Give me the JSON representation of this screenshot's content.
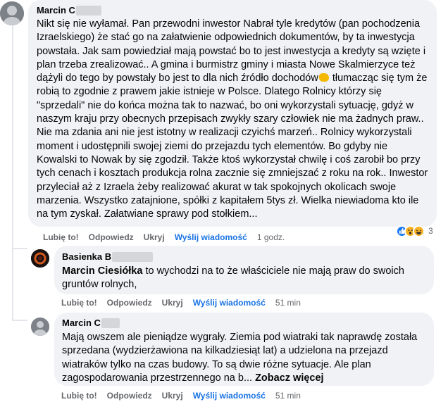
{
  "comment1": {
    "author": "Marcin C",
    "text_part1": "Nikt się nie wyłamał. Pan przewodni inwestor Nabrał tyle kredytów (pan pochodzenia Izraelskiego) że stać go na załatwienie odpowiednich dokumentów, by ta inwestycja powstała. Jak sam powiedział mają powstać bo to jest inwestycja a kredyty są wzięte i plan trzeba zrealizować.. A gmina i burmistrz gminy i miasta Nowe Skalmierzyce też dążyli do tego by powstały bo jest to dla nich źródło dochodów",
    "emoji_name": "money-hand-emoji",
    "text_part2": " tłumacząc się tym że robią to zgodnie z prawem jakie istnieje w Polsce. Dlatego Rolnicy którzy się \"sprzedali\" nie do końca można tak to nazwać, bo oni wykorzystali sytuację, gdyż w naszym kraju przy obecnych przepisach zwykły szary człowiek nie ma żadnych praw.. Nie ma zdania ani nie jest istotny w realizacji czyichś marzeń.. Rolnicy wykorzystali moment i udostępnili swojej ziemi do przejazdu tych elementów. Bo gdyby nie Kowalski to Nowak by się zgodził. Także ktoś wykorzystał chwilę i coś zarobił bo przy tych cenach i kosztach produkcja rolna zacznie się zmniejszać z roku na rok.. Inwestor przyleciał aż z Izraela żeby realizować akurat w tak spokojnych okolicach swoje marzenia. Wszystko zatajnione, spółki z kapitałem 5tys zł. Wielka niewiadoma kto ile na tym zyskał. Załatwiane sprawy pod stołkiem...",
    "actions": {
      "like": "Lubię to!",
      "reply": "Odpowiedz",
      "hide": "Ukryj",
      "send": "Wyślij wiadomość",
      "time": "1 godz."
    },
    "reactions": {
      "icons": [
        "like-reaction",
        "wow-reaction",
        "haha-reaction"
      ],
      "count": "3"
    }
  },
  "reply1": {
    "author": "Basienka B",
    "mention": "Marcin Ciesiółka",
    "text": " to wychodzi na to że właściciele nie mają praw do swoich gruntów rolnych,",
    "actions": {
      "like": "Lubię to!",
      "reply": "Odpowiedz",
      "hide": "Ukryj",
      "send": "Wyślij wiadomość",
      "time": "51 min"
    }
  },
  "reply2": {
    "author": "Marcin C",
    "text": "Mają owszem ale pieniądze wygrały. Ziemia pod wiatraki tak naprawdę została sprzedana (wydzierżawiona na kilkadziesiąt lat) a udzielona na przejazd wiatraków tylko na czas budowy. To są dwie różne sytuacje. Ale plan zagospodarowania przestrzennego na b...",
    "see_more": "Zobacz więcej",
    "actions": {
      "like": "Lubię to!",
      "reply": "Odpowiedz",
      "hide": "Ukryj",
      "send": "Wyślij wiadomość",
      "time": "51 min"
    }
  },
  "colors": {
    "bubble": "#f0f2f5",
    "link": "#1b74e4",
    "meta": "#65676b",
    "like": "#1877f2",
    "wow": "#f7b125",
    "haha": "#f7b125"
  }
}
